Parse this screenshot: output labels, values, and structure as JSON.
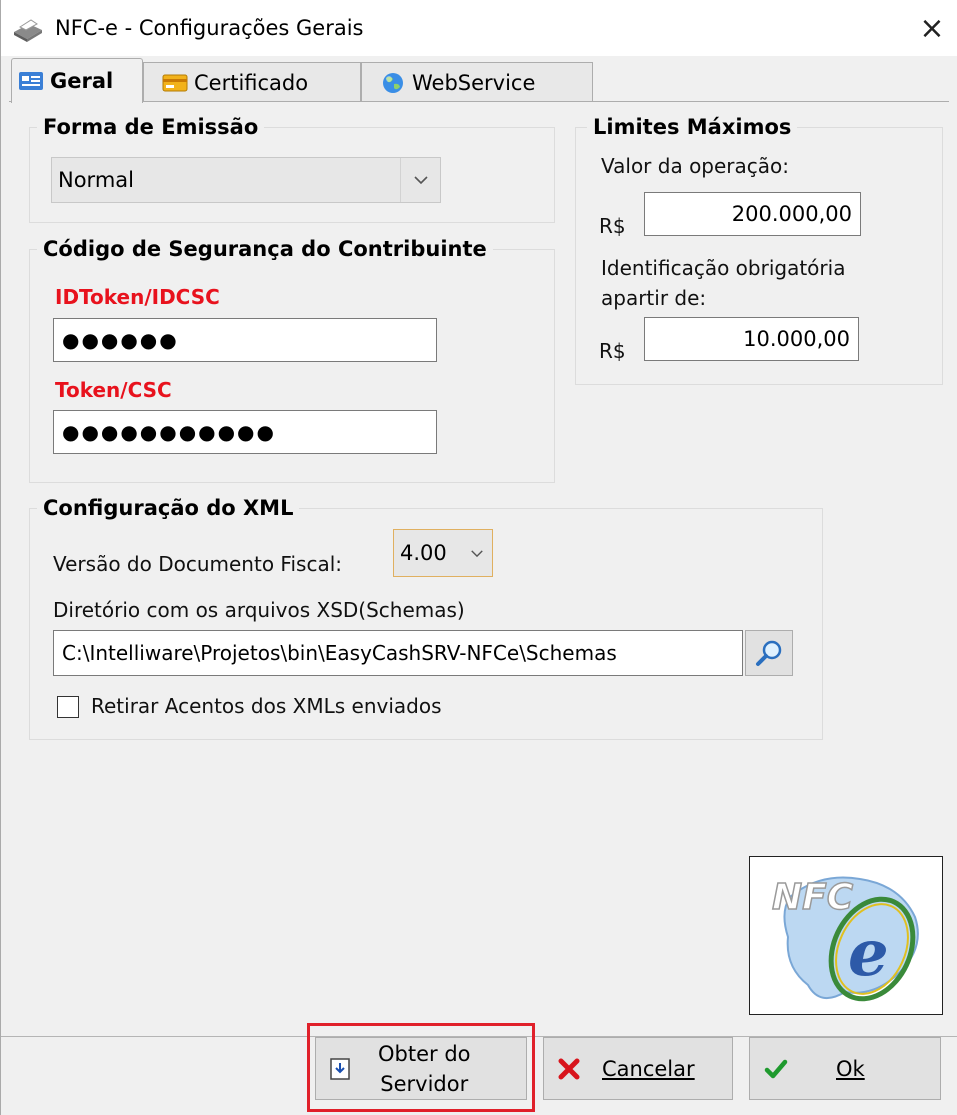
{
  "window": {
    "title": "NFC-e - Configurações Gerais",
    "close_label": "×"
  },
  "tabs": [
    {
      "label": "Geral",
      "active": true
    },
    {
      "label": "Certificado",
      "active": false
    },
    {
      "label": "WebService",
      "active": false
    }
  ],
  "forma_emissao": {
    "title": "Forma de Emissão",
    "selected": "Normal"
  },
  "limites": {
    "title": "Limites Máximos",
    "valor_operacao_label": "Valor da operação:",
    "currency": "R$",
    "valor_operacao": "200.000,00",
    "identificacao_label_line1": "Identificação obrigatória",
    "identificacao_label_line2": "apartir de:",
    "identificacao_valor": "10.000,00"
  },
  "csc": {
    "title": "Código de Segurança do Contribuinte",
    "idtoken_label": "IDToken/IDCSC",
    "idtoken_value": "●●●●●●",
    "token_label": "Token/CSC",
    "token_value": "●●●●●●●●●●●"
  },
  "xml": {
    "title": "Configuração do XML",
    "versao_label": "Versão do Documento Fiscal:",
    "versao_selected": "4.00",
    "diretorio_label": "Diretório com os arquivos XSD(Schemas)",
    "diretorio_value": "C:\\Intelliware\\Projetos\\bin\\EasyCashSRV-NFCe\\Schemas",
    "retirar_acentos_label": "Retirar Acentos dos XMLs enviados",
    "retirar_acentos_checked": false
  },
  "logo_text": "NFC-e",
  "buttons": {
    "obter_line1": "Obter do",
    "obter_line2": "Servidor",
    "cancelar": "Cancelar",
    "ok": "Ok"
  }
}
